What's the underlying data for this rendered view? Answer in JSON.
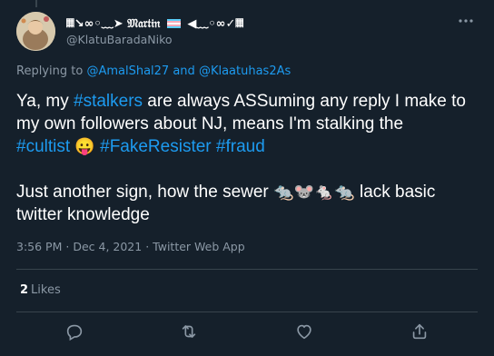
{
  "tweet": {
    "display_name": "𝔐𝔞𝔯𝔱𝔦𝔫",
    "name_decor_left": "𝄜↘︎∞◦﹏➤",
    "name_decor_right": "◀︎﹏◦∞✓𝄜",
    "handle": "@KlatuBaradaNiko",
    "replying_prefix": "Replying to",
    "reply_to_1": "@AmalShal27",
    "reply_and": "and",
    "reply_to_2": "@Klaatuhas2As",
    "text_line1_a": "Ya, my ",
    "text_tag1": "#stalkers",
    "text_line1_b": " are always ASSuming any reply I make to my own followers about NJ, means I'm stalking the",
    "text_tag2": "#cultist",
    "text_emoji1": "😛",
    "text_tag3": "#FakeResister",
    "text_tag4": "#fraud",
    "text_line2": "Just another sign, how the sewer",
    "text_emoji_rats": "🐀🐭🐁🐀",
    "text_line2_b": "lack basic twitter knowledge",
    "time": "3:56 PM",
    "date": "Dec 4, 2021",
    "source": "Twitter Web App",
    "sep": "·",
    "likes_count": "2",
    "likes_label": "Likes"
  },
  "icons": {
    "more": "more-horizontal-icon",
    "reply": "reply-icon",
    "retweet": "retweet-icon",
    "like": "like-icon",
    "share": "share-icon"
  },
  "colors": {
    "background": "#15202b",
    "accent": "#1d9bf0",
    "muted": "#8b98a5",
    "divider": "#38444d"
  }
}
